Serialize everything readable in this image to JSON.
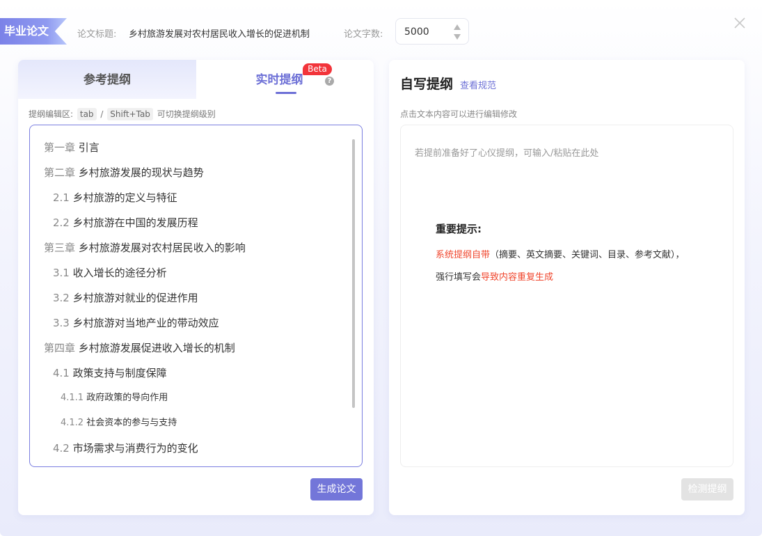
{
  "header": {
    "tag_label": "毕业论文",
    "title_label": "论文标题:",
    "title_value": "乡村旅游发展对农村居民收入增长的促进机制",
    "count_label": "论文字数:",
    "count_value": "5000"
  },
  "left_panel": {
    "tab_reference": "参考提纲",
    "tab_realtime": "实时提纲",
    "beta_badge": "Beta",
    "hint_prefix": "提纲编辑区:",
    "hint_key1": "tab",
    "hint_sep": "/",
    "hint_key2": "Shift+Tab",
    "hint_suffix": "可切换提纲级别",
    "outline": [
      {
        "num": "第一章",
        "text": "引言",
        "level": 1
      },
      {
        "num": "第二章",
        "text": "乡村旅游发展的现状与趋势",
        "level": 1
      },
      {
        "num": "2.1",
        "text": "乡村旅游的定义与特征",
        "level": 2
      },
      {
        "num": "2.2",
        "text": "乡村旅游在中国的发展历程",
        "level": 2
      },
      {
        "num": "第三章",
        "text": "乡村旅游发展对农村居民收入的影响",
        "level": 1
      },
      {
        "num": "3.1",
        "text": "收入增长的途径分析",
        "level": 2
      },
      {
        "num": "3.2",
        "text": "乡村旅游对就业的促进作用",
        "level": 2
      },
      {
        "num": "3.3",
        "text": "乡村旅游对当地产业的带动效应",
        "level": 2
      },
      {
        "num": "第四章",
        "text": "乡村旅游发展促进收入增长的机制",
        "level": 1
      },
      {
        "num": "4.1",
        "text": "政策支持与制度保障",
        "level": 2
      },
      {
        "num": "4.1.1",
        "text": "政府政策的导向作用",
        "level": 3
      },
      {
        "num": "4.1.2",
        "text": "社会资本的参与与支持",
        "level": 3
      },
      {
        "num": "4.2",
        "text": "市场需求与消费行为的变化",
        "level": 2
      }
    ],
    "generate_button": "生成论文"
  },
  "right_panel": {
    "title": "自写提纲",
    "rules_link": "查看规范",
    "hint": "点击文本内容可以进行编辑修改",
    "placeholder": "若提前准备好了心仪提纲，可输入/粘贴在此处",
    "notice_title": "重要提示:",
    "notice_red1": "系统提纲自带",
    "notice_rest1": "（摘要、英文摘要、关键词、目录、参考文献），",
    "notice_prefix2": "强行填写会",
    "notice_red2": "导致内容重复生成",
    "check_button": "检测提纲"
  },
  "colors": {
    "accent": "#6c6fd6",
    "warning_red": "#f0452c",
    "beta_red": "#f2343a"
  }
}
